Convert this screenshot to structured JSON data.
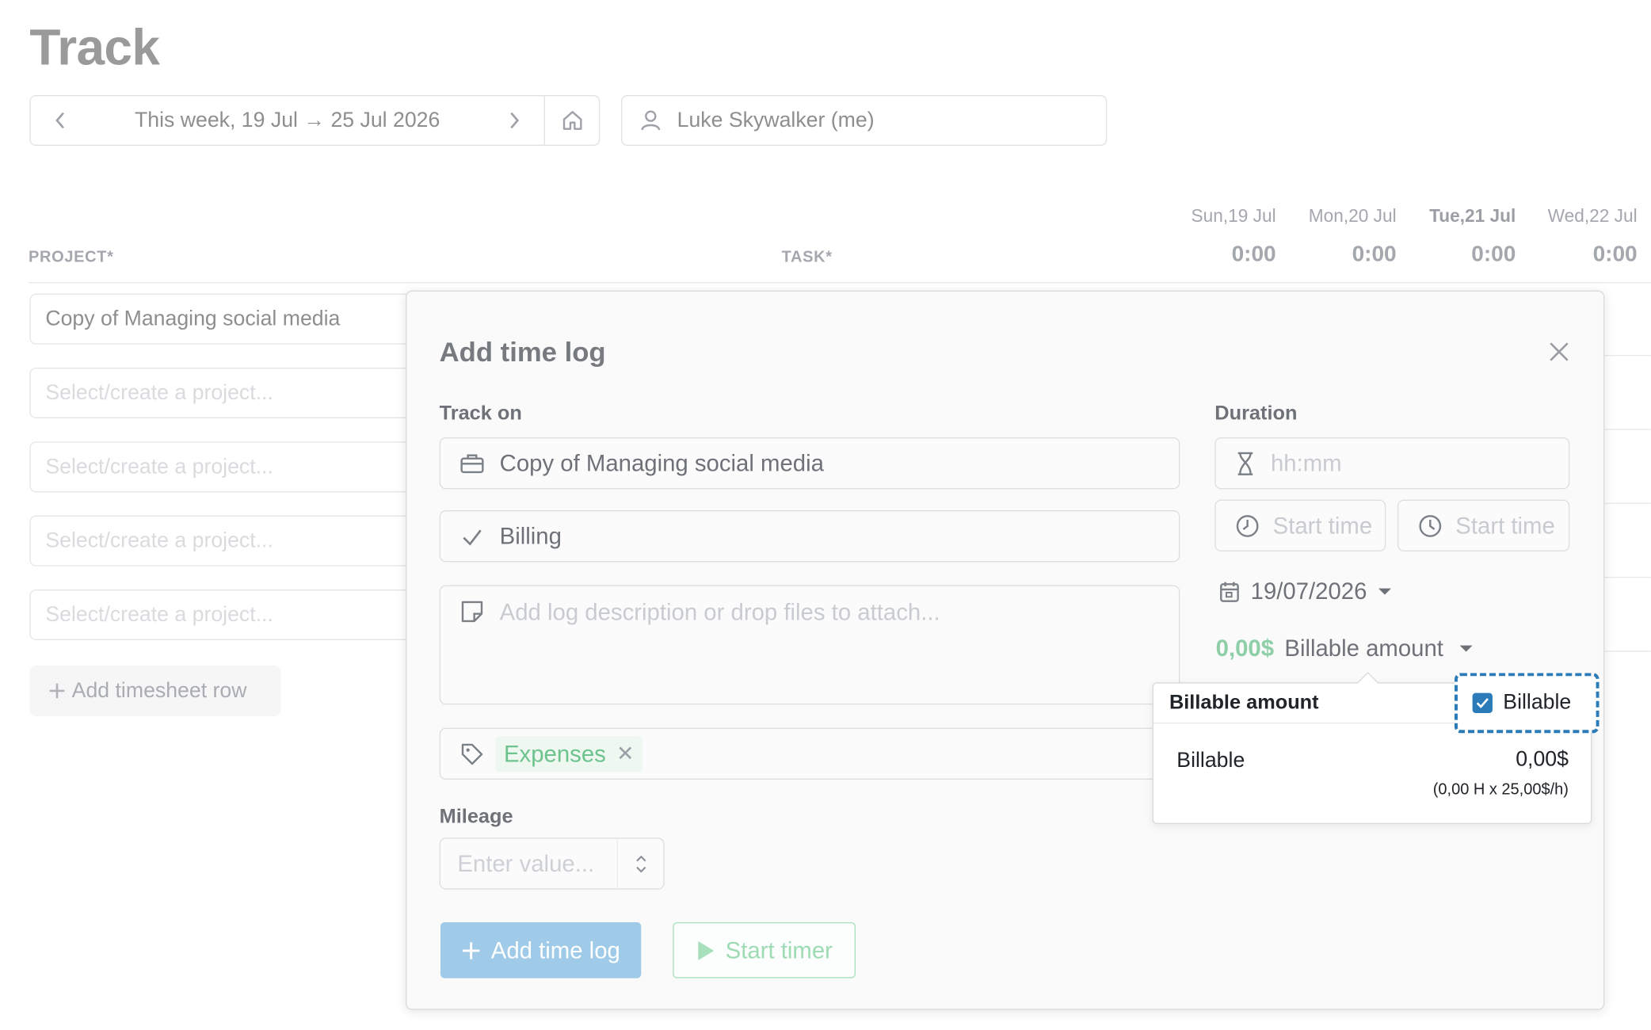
{
  "page": {
    "title": "Track",
    "week_range": "This week, 19 Jul → 25 Jul 2026",
    "user": "Luke Skywalker (me)"
  },
  "timesheet": {
    "col_project": "PROJECT*",
    "col_task": "TASK*",
    "days": [
      {
        "label": "Sun,19 Jul",
        "total": "0:00"
      },
      {
        "label": "Mon,20 Jul",
        "total": "0:00"
      },
      {
        "label": "Tue,21 Jul",
        "total": "0:00"
      },
      {
        "label": "Wed,22 Jul",
        "total": "0:00"
      }
    ],
    "rows": [
      {
        "project": "Copy of Managing social media"
      },
      {
        "placeholder": "Select/create a project..."
      },
      {
        "placeholder": "Select/create a project..."
      },
      {
        "placeholder": "Select/create a project..."
      },
      {
        "placeholder": "Select/create a project..."
      }
    ],
    "add_row_label": "Add timesheet row"
  },
  "modal": {
    "title": "Add time log",
    "track_on_label": "Track on",
    "project_value": "Copy of Managing social media",
    "task_value": "Billing",
    "description_placeholder": "Add log description or drop files to attach...",
    "tag": "Expenses",
    "mileage_label": "Mileage",
    "mileage_placeholder": "Enter value...",
    "duration_label": "Duration",
    "duration_placeholder": "hh:mm",
    "start_time_placeholder": "Start time",
    "end_time_placeholder": "Start time",
    "date_value": "19/07/2026",
    "billable_amount_value": "0,00$",
    "billable_amount_label": "Billable amount",
    "add_button": "Add time log",
    "start_timer_button": "Start timer"
  },
  "popover": {
    "title": "Billable amount",
    "toggle_label": "Billable",
    "toggle_checked": true,
    "row_label": "Billable",
    "row_value": "0,00$",
    "row_sub": "(0,00 H x 25,00$/h)"
  },
  "colors": {
    "accent": "#2b7bb9",
    "primary_button": "#9fcbe8",
    "green": "#8ecfa8"
  }
}
